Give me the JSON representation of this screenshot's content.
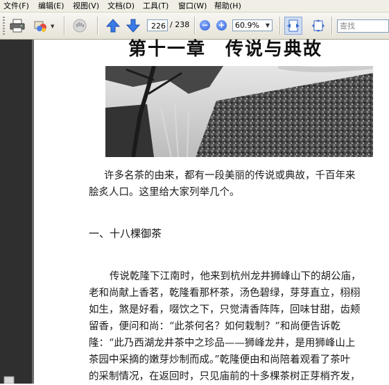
{
  "menu": {
    "items": [
      "文件(F)",
      "编辑(E)",
      "视图(V)",
      "文档(D)",
      "工具(T)",
      "窗口(W)",
      "帮助(H)"
    ]
  },
  "toolbar": {
    "page_current": "226",
    "page_total": "/ 238",
    "zoom": "60.9%",
    "search_placeholder": "查找",
    "icons": [
      "print-icon",
      "email-organize-icon",
      "hand-tool-icon",
      "previous-page-icon",
      "next-page-icon",
      "zoom-out-icon",
      "zoom-in-icon",
      "fit-width-icon",
      "fit-page-icon"
    ]
  },
  "document": {
    "chapter_title": "第十一章　传说与典故",
    "intro_lines": [
      "许多名茶的由来，都有一段美丽的传说或典故，千百年来",
      "脍炙人口。这里给大家列举几个。"
    ],
    "section_heading": "一、十八棵御茶",
    "body_lines": [
      "传说乾隆下江南时，他来到杭州龙井狮峰山下的胡公庙，",
      "老和尚献上香茗，乾隆看那杯茶，汤色碧绿，芽芽直立，栩栩",
      "如生，煞是好看，啜饮之下，只觉清香阵阵，回味甘甜，齿颊",
      "留香，便问和尚：“此茶何名？如何栽制？”和尚便告诉乾",
      "隆：“此乃西湖龙井茶中之珍品——狮峰龙井，是用狮峰山上",
      "茶园中采摘的嫩芽炒制而成。”乾隆便由和尚陪着观看了茶叶",
      "的采制情况，在返回时，只见庙前的十多棵茶树正芽梢齐发，"
    ]
  },
  "colors": {
    "menubar_bg": "#f0eee5",
    "left_strip": "#2f2f2f",
    "accent_blue": "#2a5bd6"
  }
}
